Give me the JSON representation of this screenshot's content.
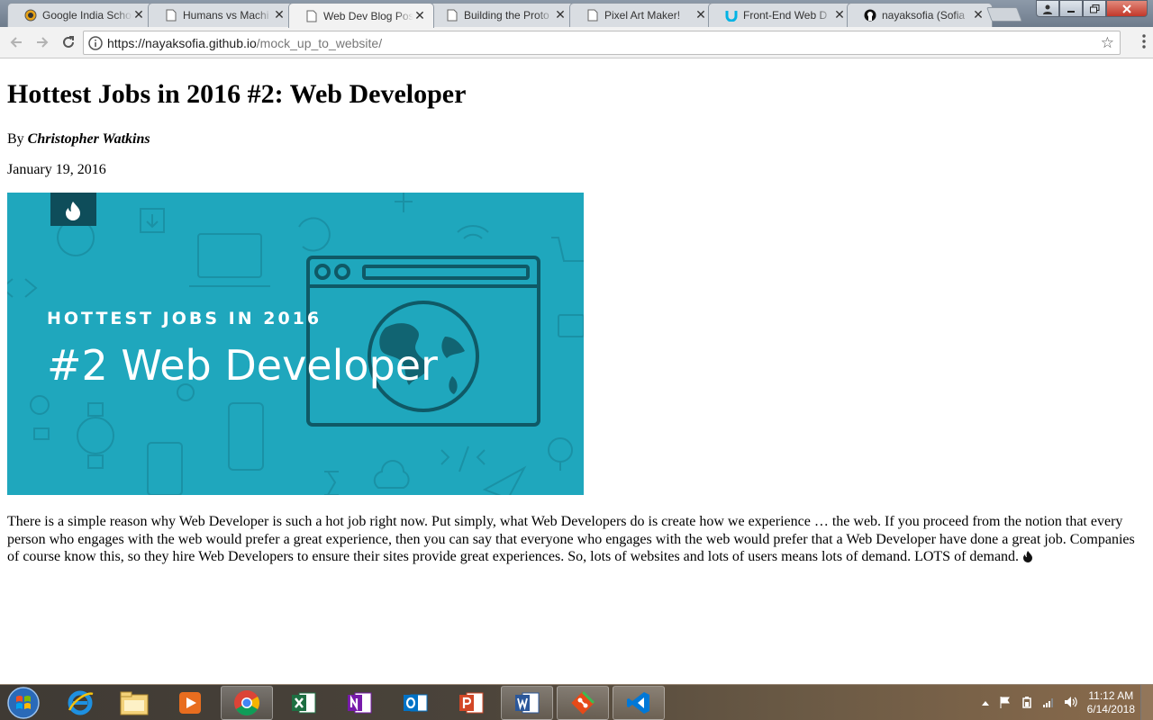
{
  "browser": {
    "tabs": [
      {
        "title": "Google India Scho",
        "icon": "google-favicon-icon",
        "active": false
      },
      {
        "title": "Humans vs Machi",
        "icon": "page-icon",
        "active": false
      },
      {
        "title": "Web Dev Blog Pos",
        "icon": "page-icon",
        "active": true
      },
      {
        "title": "Building the Proto",
        "icon": "page-icon",
        "active": false
      },
      {
        "title": "Pixel Art Maker!",
        "icon": "page-icon",
        "active": false
      },
      {
        "title": "Front-End Web D",
        "icon": "udacity-icon",
        "active": false
      },
      {
        "title": "nayaksofia (Sofia",
        "icon": "github-icon",
        "active": false
      }
    ],
    "close_glyph": "✕",
    "url_host": "https://nayaksofia.github.io",
    "url_path": "/mock_up_to_website/"
  },
  "page": {
    "title": "Hottest Jobs in 2016 #2: Web Developer",
    "by_prefix": "By ",
    "author": "Christopher Watkins",
    "date": "January 19, 2016",
    "hero": {
      "kicker": "HOTTEST JOBS IN 2016",
      "headline": "#2 Web Developer",
      "bg_color": "#1ea6bd"
    },
    "body": "There is a simple reason why Web Developer is such a hot job right now. Put simply, what Web Developers do is create how we experience … the web. If you proceed from the notion that every person who engages with the web would prefer a great experience, then you can say that everyone who engages with the web would prefer that a Web Developer have done a great job. Companies of course know this, so they hire Web Developers to ensure their sites provide great experiences. So, lots of websites and lots of users means lots of demand. LOTS of demand."
  },
  "taskbar": {
    "apps": [
      {
        "name": "internet-explorer-icon"
      },
      {
        "name": "file-explorer-icon"
      },
      {
        "name": "media-player-icon"
      },
      {
        "name": "chrome-icon"
      },
      {
        "name": "excel-icon"
      },
      {
        "name": "onenote-icon"
      },
      {
        "name": "outlook-icon"
      },
      {
        "name": "powerpoint-icon"
      },
      {
        "name": "word-icon"
      },
      {
        "name": "git-icon"
      },
      {
        "name": "vscode-icon"
      }
    ],
    "time": "11:12 AM",
    "date": "6/14/2018"
  }
}
